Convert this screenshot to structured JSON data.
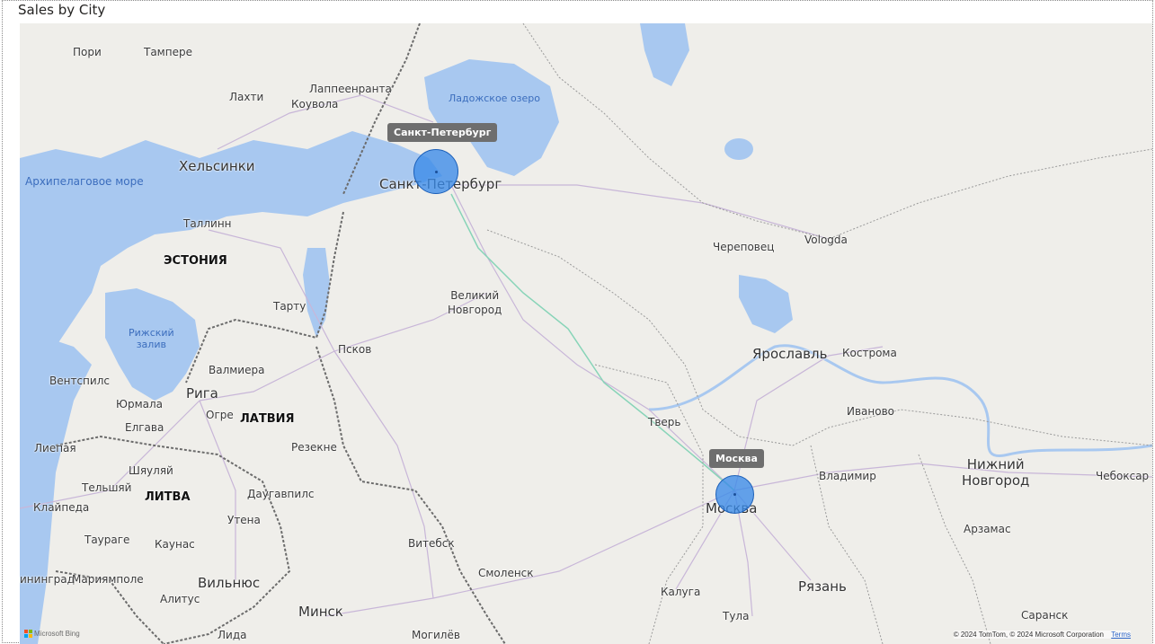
{
  "visual": {
    "title": "Sales by City"
  },
  "colors": {
    "water": "#a8c8f0",
    "land": "#efeeea",
    "bubble": "#3a8ae8",
    "border": "#666666"
  },
  "labels": {
    "pori": "Пори",
    "tampere": "Тампере",
    "lahti": "Лахти",
    "lappeenranta": "Лаппеенранта",
    "kouvola": "Коувола",
    "helsinki": "Хельсинки",
    "archipelago": "Архипелаговое море",
    "ladoga": "Ладожское озеро",
    "spb": "Санкт-Петербург",
    "tallinn": "Таллинн",
    "estonia": "ЭСТОНИЯ",
    "cherepovets": "Череповец",
    "vologda": "Vologda",
    "velikiy": "Великий\nНовгород",
    "tartu": "Тарту",
    "riga_gulf": "Рижский\nзалив",
    "pskov": "Псков",
    "yaroslavl": "Ярославль",
    "kostroma": "Кострома",
    "ventspils": "Вентспилс",
    "valmiera": "Валмиера",
    "riga": "Рига",
    "jurmala": "Юрмала",
    "ogre": "Огре",
    "latvia": "ЛАТВИЯ",
    "jelgava": "Елгава",
    "tver": "Тверь",
    "ivanovo": "Иваново",
    "liepaja": "Лиепая",
    "rezekne": "Резекне",
    "shiaulyai": "Шяуляй",
    "telshyai": "Тельшяй",
    "lithuania": "ЛИТВА",
    "klaipeda": "Клайпеда",
    "daugavpils": "Даугавпилс",
    "vladimir": "Владимир",
    "nizhny": "Нижний\nНовгород",
    "cheboksary": "Чебоксар",
    "utena": "Утена",
    "taurage": "Таураге",
    "kaunas": "Каунас",
    "vitebsk": "Витебск",
    "smolensk": "Смоленск",
    "moscow": "Москва",
    "arzamas": "Арзамас",
    "kaliningrad": "ининград",
    "mariyampole": "Мариямполе",
    "alytus": "Алитус",
    "vilnius": "Вильнюс",
    "kaluga": "Калуга",
    "ryazan": "Рязань",
    "minsk": "Минск",
    "lida": "Лида",
    "mogilev": "Могилёв",
    "tula": "Тула",
    "saransk": "Саранск"
  },
  "bubbles": [
    {
      "city": "Санкт-Петербург"
    },
    {
      "city": "Москва"
    }
  ],
  "attribution": {
    "bing": "Microsoft Bing",
    "copyright": "© 2024 TomTom, © 2024 Microsoft Corporation",
    "terms": "Terms"
  }
}
